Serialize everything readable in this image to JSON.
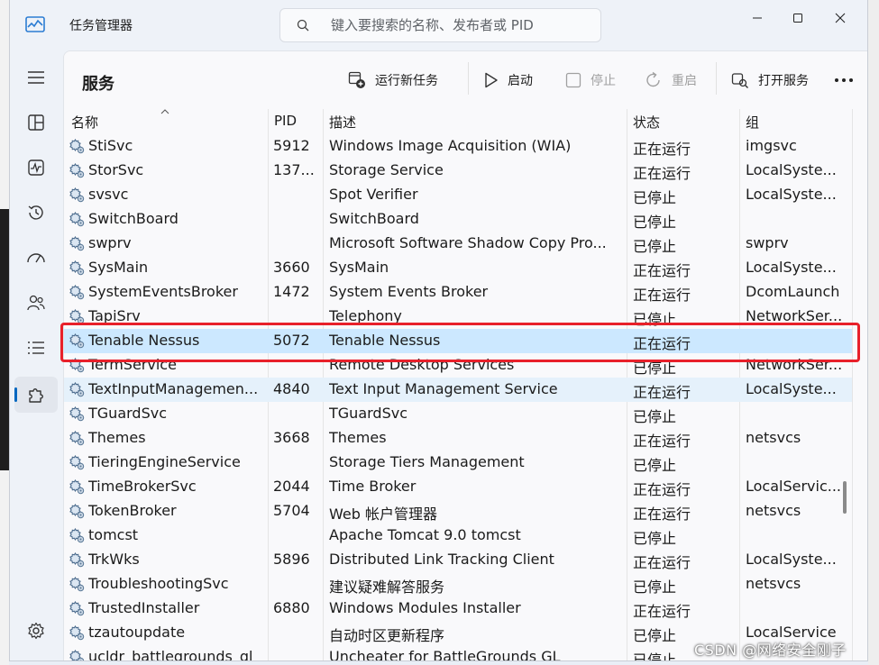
{
  "window": {
    "title": "任务管理器"
  },
  "search": {
    "placeholder": "键入要搜索的名称、发布者或 PID"
  },
  "page": {
    "title": "服务"
  },
  "toolbar": {
    "run_new_task": "运行新任务",
    "start": "启动",
    "stop": "停止",
    "restart": "重启",
    "open_services": "打开服务"
  },
  "columns": {
    "name": "名称",
    "pid": "PID",
    "description": "描述",
    "status": "状态",
    "group": "组"
  },
  "services": [
    {
      "name": "StiSvc",
      "pid": "5912",
      "description": "Windows Image Acquisition (WIA)",
      "status": "正在运行",
      "group": "imgsvc"
    },
    {
      "name": "StorSvc",
      "pid": "137...",
      "description": "Storage Service",
      "status": "正在运行",
      "group": "LocalSyste..."
    },
    {
      "name": "svsvc",
      "pid": "",
      "description": "Spot Verifier",
      "status": "已停止",
      "group": "LocalSyste..."
    },
    {
      "name": "SwitchBoard",
      "pid": "",
      "description": "SwitchBoard",
      "status": "已停止",
      "group": ""
    },
    {
      "name": "swprv",
      "pid": "",
      "description": "Microsoft Software Shadow Copy Pro...",
      "status": "已停止",
      "group": "swprv"
    },
    {
      "name": "SysMain",
      "pid": "3660",
      "description": "SysMain",
      "status": "正在运行",
      "group": "LocalSyste..."
    },
    {
      "name": "SystemEventsBroker",
      "pid": "1472",
      "description": "System Events Broker",
      "status": "正在运行",
      "group": "DcomLaunch"
    },
    {
      "name": "TapiSrv",
      "pid": "",
      "description": "Telephony",
      "status": "已停止",
      "group": "NetworkSer..."
    },
    {
      "name": "Tenable Nessus",
      "pid": "5072",
      "description": "Tenable Nessus",
      "status": "正在运行",
      "group": ""
    },
    {
      "name": "TermService",
      "pid": "",
      "description": "Remote Desktop Services",
      "status": "已停止",
      "group": "NetworkSer..."
    },
    {
      "name": "TextInputManagemen...",
      "pid": "4840",
      "description": "Text Input Management Service",
      "status": "正在运行",
      "group": "LocalSyste..."
    },
    {
      "name": "TGuardSvc",
      "pid": "",
      "description": "TGuardSvc",
      "status": "已停止",
      "group": ""
    },
    {
      "name": "Themes",
      "pid": "3668",
      "description": "Themes",
      "status": "正在运行",
      "group": "netsvcs"
    },
    {
      "name": "TieringEngineService",
      "pid": "",
      "description": "Storage Tiers Management",
      "status": "已停止",
      "group": ""
    },
    {
      "name": "TimeBrokerSvc",
      "pid": "2044",
      "description": "Time Broker",
      "status": "正在运行",
      "group": "LocalServic..."
    },
    {
      "name": "TokenBroker",
      "pid": "5704",
      "description": "Web 帐户管理器",
      "status": "正在运行",
      "group": "netsvcs"
    },
    {
      "name": "tomcst",
      "pid": "",
      "description": "Apache Tomcat 9.0 tomcst",
      "status": "已停止",
      "group": ""
    },
    {
      "name": "TrkWks",
      "pid": "5896",
      "description": "Distributed Link Tracking Client",
      "status": "正在运行",
      "group": "LocalSyste..."
    },
    {
      "name": "TroubleshootingSvc",
      "pid": "",
      "description": "建议疑难解答服务",
      "status": "已停止",
      "group": "netsvcs"
    },
    {
      "name": "TrustedInstaller",
      "pid": "6880",
      "description": "Windows Modules Installer",
      "status": "正在运行",
      "group": ""
    },
    {
      "name": "tzautoupdate",
      "pid": "",
      "description": "自动时区更新程序",
      "status": "已停止",
      "group": "LocalService"
    },
    {
      "name": "ucldr_battlegrounds_gl",
      "pid": "",
      "description": "Uncheater for BattleGrounds GL",
      "status": "已停止",
      "group": ""
    }
  ],
  "selected_index": 8,
  "hover_index": 10,
  "watermark": "CSDN @网络安全刚子",
  "colors": {
    "accent": "#0067c0",
    "selected_row": "#cce8ff",
    "highlight_box": "#e8202a"
  }
}
